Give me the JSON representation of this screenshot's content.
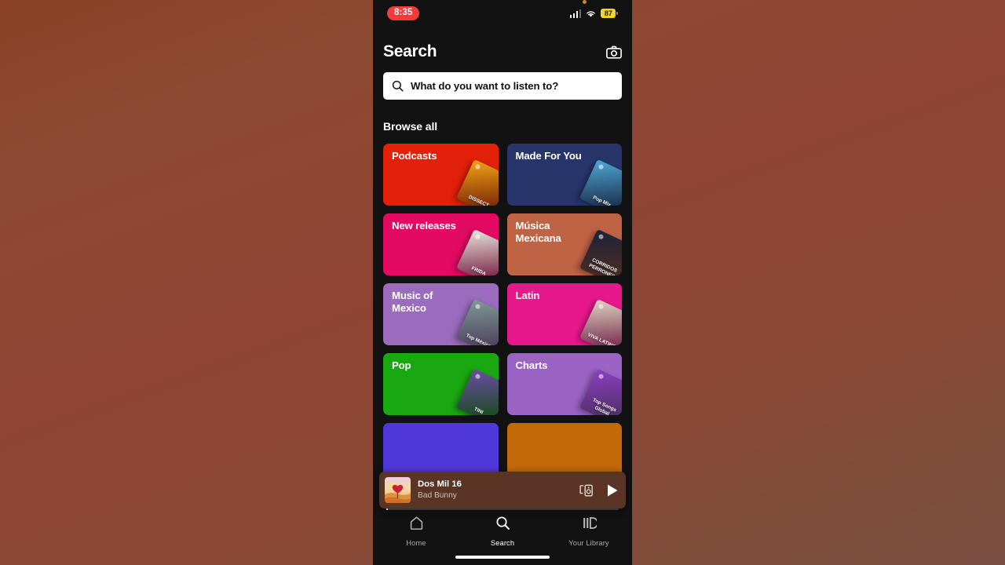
{
  "status_bar": {
    "time": "8:35",
    "battery_level": "87",
    "icons": [
      "cellular-signal-icon",
      "wifi-icon",
      "battery-icon"
    ]
  },
  "header": {
    "title": "Search",
    "camera_icon": "camera-icon"
  },
  "search": {
    "placeholder": "What do you want to listen to?",
    "value": "",
    "icon": "search-icon"
  },
  "browse": {
    "section_title": "Browse all",
    "cards": [
      {
        "label": "Podcasts",
        "color": "#e32009",
        "thumb_text": "DISSECT",
        "thumb_color": "#f2a615"
      },
      {
        "label": "Made For You",
        "color": "#27356b",
        "thumb_text": "Pop Mix",
        "thumb_color": "#4fa8d8"
      },
      {
        "label": "New releases",
        "color": "#e40a64",
        "thumb_text": "FRIDA",
        "thumb_color": "#e8e4dc"
      },
      {
        "label": "Música Mexicana",
        "color": "#bf6345",
        "thumb_text": "CORRIDOS PERRONES",
        "thumb_color": "#1c2338"
      },
      {
        "label": "Music of Mexico",
        "color": "#9b6bbd",
        "thumb_text": "Top México",
        "thumb_color": "#7e9a94"
      },
      {
        "label": "Latin",
        "color": "#e7188c",
        "thumb_text": "VIVA LATINO",
        "thumb_color": "#ded6c0"
      },
      {
        "label": "Pop",
        "color": "#1aa812",
        "thumb_text": "TINI",
        "thumb_color": "#6d4ca8"
      },
      {
        "label": "Charts",
        "color": "#9a63c4",
        "thumb_text": "Top Songs Global",
        "thumb_color": "#8c3fc0"
      },
      {
        "label": "",
        "color": "#5038d8",
        "thumb_text": "",
        "thumb_color": "#5038d8"
      },
      {
        "label": "",
        "color": "#c2690a",
        "thumb_text": "",
        "thumb_color": "#c2690a"
      }
    ]
  },
  "now_playing": {
    "track": "Dos Mil 16",
    "artist": "Bad Bunny",
    "devices_icon": "spotify-connect-devices-icon",
    "play_icon": "play-icon",
    "album_art": "album-art-un-verano-sin-ti"
  },
  "bottom_nav": {
    "items": [
      {
        "label": "Home",
        "icon": "home-icon",
        "active": false
      },
      {
        "label": "Search",
        "icon": "search-icon",
        "active": true
      },
      {
        "label": "Your Library",
        "icon": "library-icon",
        "active": false
      }
    ]
  }
}
